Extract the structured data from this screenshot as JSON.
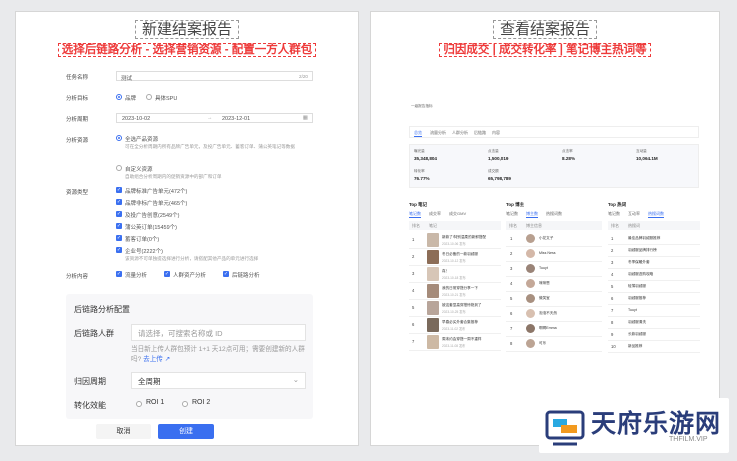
{
  "left": {
    "title": "新建结案报告",
    "subtitle": "选择后链路分析 - 选择营销资源 - 配置一方人群包",
    "form": {
      "task_name_label": "任务名称",
      "task_name_value": "测试",
      "task_name_count": "2/20",
      "target_label": "分析目标",
      "target_opt1": "品牌",
      "target_opt2": "具体SPU",
      "period_label": "分析周期",
      "period_start": "2023-10-02",
      "period_end": "2023-12-01",
      "resource_label": "分析资源",
      "res_opt1": "全选产品资源",
      "res_opt1_desc": "可在全分析周期内所有品牌广告单元，及投广告单元、蓄客订单、蒲公英笔记等数据",
      "res_opt2": "自定义资源",
      "res_opt2_desc": "自助组合分析周期内的促销资源中的部广和订单",
      "restype_label": "资源类型",
      "restypes": [
        "品牌标准广告单元(472个)",
        "品牌非标广告单元(465个)",
        "及投广告创意(2549个)",
        "蒲公英订单(15459个)",
        "蓄客订单(0个)",
        "企业号(2222个)"
      ],
      "restype_desc": "该资源不可单独提选择进行分析，请搭配其他产品的单元进行选择",
      "content_label": "分析内容",
      "content_opt1": "流量分析",
      "content_opt2": "人群资产分析",
      "content_opt3": "后链路分析"
    },
    "config": {
      "title": "后链路分析配置",
      "crowd_label": "后链路人群",
      "crowd_placeholder": "请选择，可搜索名称或 ID",
      "crowd_hint": "当日新上传人群包预计 1+1 天12点可用；需要创建新的人群吗?",
      "upload_link": "去上传",
      "attr_label": "归因周期",
      "attr_value": "全周期",
      "roi_label": "转化效能",
      "roi1": "ROI 1",
      "roi2": "ROI 2"
    },
    "buttons": {
      "cancel": "取消",
      "create": "创建"
    }
  },
  "right": {
    "title": "查看结案报告",
    "subtitle": "归因成交 | 成交转化率 | 笔记博主热词等",
    "report": {
      "head": "一级报告指标",
      "tabs": [
        "总览",
        "流量分析",
        "人群分析",
        "后链路",
        "内容"
      ],
      "metrics": [
        {
          "label": "曝光量",
          "value": "35,348,804"
        },
        {
          "label": "点击量",
          "value": "1,500,019"
        },
        {
          "label": "点击率",
          "value": "8.28%"
        },
        {
          "label": "互动量",
          "value": "10,064.1M"
        },
        {
          "label": "转化率",
          "value": "76.77%"
        },
        {
          "label": "成交额",
          "value": "65,798,789"
        }
      ]
    },
    "top_notes": {
      "title": "Top 笔记",
      "tabs": [
        "笔记数",
        "成交率",
        "成交GMV"
      ],
      "headers": [
        "排名",
        "笔记"
      ],
      "rows": [
        {
          "rank": "1",
          "title": "新款了!特别温柔的新鲜搭配",
          "sub": "2023-10-06 发布"
        },
        {
          "rank": "2",
          "title": "冬日必备的一款羽绒服",
          "sub": "2023-10-12 发布"
        },
        {
          "rank": "3",
          "title": "真！",
          "sub": "2023-10-18 发布"
        },
        {
          "rank": "4",
          "title": "我的日常穿搭分享一下",
          "sub": "2023-10-21 发布"
        },
        {
          "rank": "5",
          "title": "被这套显高穿搭惊艳到了",
          "sub": "2023-10-25 发布"
        },
        {
          "rank": "6",
          "title": "早春必买外套合集推荐",
          "sub": "2023-11-02 发布"
        },
        {
          "rank": "7",
          "title": "周末约会穿搭一周不重样",
          "sub": "2023-11-08 发布"
        }
      ]
    },
    "top_bloggers": {
      "title": "Top 博主",
      "tabs": [
        "笔记数",
        "博主数",
        "热搜词数"
      ],
      "headers": [
        "排名",
        "博主信息"
      ],
      "rows": [
        {
          "rank": "1",
          "name": "小花文子"
        },
        {
          "rank": "2",
          "name": "Miss Ness"
        },
        {
          "rank": "3",
          "name": "Tuuyt"
        },
        {
          "rank": "4",
          "name": "咪咪恩"
        },
        {
          "rank": "5",
          "name": "微笑宝"
        },
        {
          "rank": "6",
          "name": "泡泡不天然"
        },
        {
          "rank": "7",
          "name": "啊啊Emma"
        },
        {
          "rank": "8",
          "name": "可乐"
        }
      ]
    },
    "top_words": {
      "title": "Top 热词",
      "tabs": [
        "笔记数",
        "互动率",
        "热搜词数"
      ],
      "headers": [
        "排名",
        "热搜词"
      ],
      "rows": [
        {
          "rank": "1",
          "word": "最佳品牌羽绒服推荐"
        },
        {
          "rank": "2",
          "word": "羽绒服品牌排行榜"
        },
        {
          "rank": "3",
          "word": "冬季保暖外套"
        },
        {
          "rank": "4",
          "word": "羽绒服选购攻略"
        },
        {
          "rank": "5",
          "word": "轻薄羽绒服"
        },
        {
          "rank": "6",
          "word": "羽绒服推荐"
        },
        {
          "rank": "7",
          "word": "Tuuyt"
        },
        {
          "rank": "8",
          "word": "羽绒服清洗"
        },
        {
          "rank": "9",
          "word": "长款羽绒服"
        },
        {
          "rank": "10",
          "word": "新品推荐"
        }
      ]
    }
  },
  "watermark": {
    "text": "天府乐游网",
    "url": "THFILM.VIP"
  },
  "colors": {
    "accent": "#3a6ff0",
    "highlight": "#ee3b3b"
  }
}
